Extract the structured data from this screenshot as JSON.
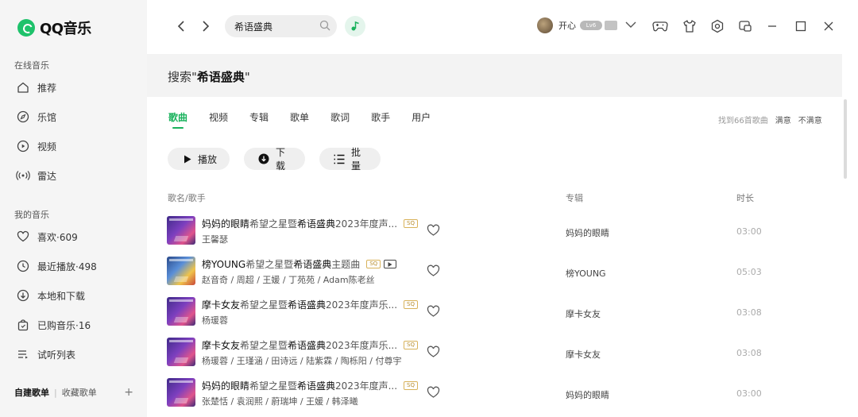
{
  "app": {
    "name": "QQ音乐"
  },
  "sidebar": {
    "online_heading": "在线音乐",
    "online_items": [
      {
        "label": "推荐",
        "icon": "home-icon"
      },
      {
        "label": "乐馆",
        "icon": "compass-icon"
      },
      {
        "label": "视频",
        "icon": "play-circle-icon"
      },
      {
        "label": "雷达",
        "icon": "radar-icon"
      }
    ],
    "my_heading": "我的音乐",
    "my_items": [
      {
        "label": "喜欢·609",
        "icon": "heart-icon"
      },
      {
        "label": "最近播放·498",
        "icon": "clock-icon"
      },
      {
        "label": "本地和下载",
        "icon": "download-icon"
      },
      {
        "label": "已购音乐·16",
        "icon": "bag-icon"
      },
      {
        "label": "试听列表",
        "icon": "list-icon"
      }
    ],
    "bottom": {
      "created": "自建歌单",
      "collected": "收藏歌单",
      "add": "+"
    }
  },
  "header": {
    "search_value": "希语盛典",
    "user_name": "开心",
    "badge_text": "Lv6"
  },
  "main": {
    "search_prefix": "搜索\"",
    "search_keyword": "希语盛典",
    "search_suffix": "\"",
    "tabs": [
      "歌曲",
      "视频",
      "专辑",
      "歌单",
      "歌词",
      "歌手",
      "用户"
    ],
    "result_count": "找到66首歌曲",
    "satisfied": "满意",
    "unsatisfied": "不满意",
    "actions": {
      "play": "播放",
      "download": "下载",
      "batch": "批量"
    },
    "columns": {
      "song": "歌名/歌手",
      "album": "专辑",
      "duration": "时长"
    },
    "songs": [
      {
        "name": "妈妈的眼睛",
        "desc_pre": "希望之星暨",
        "desc_hl": "希语盛典",
        "desc_post": "2023年度声...",
        "artists": "王馨瑟",
        "album": "妈妈的眼睛",
        "duration": "03:00",
        "sq": "SQ"
      },
      {
        "name": "榜YOUNG",
        "desc_pre": "希望之星暨",
        "desc_hl": "希语盛典",
        "desc_post": "主题曲",
        "artists": "赵音奇 / 周超 / 王媛 / 丁苑苑 / Adam陈老丝",
        "album": "榜YOUNG",
        "duration": "05:03",
        "sq": "SQ"
      },
      {
        "name": "摩卡女友",
        "desc_pre": "希望之星暨",
        "desc_hl": "希语盛典",
        "desc_post": "2023年度声乐...",
        "artists": "杨瑗蓉",
        "album": "摩卡女友",
        "duration": "03:08",
        "sq": "SQ"
      },
      {
        "name": "摩卡女友",
        "desc_pre": "希望之星暨",
        "desc_hl": "希语盛典",
        "desc_post": "2023年度声乐...",
        "artists": "杨瑗蓉 / 王瑾涵 / 田诗远 / 陆紫霖 / 陶栎阳 / 付尊宇",
        "album": "摩卡女友",
        "duration": "03:08",
        "sq": "SQ"
      },
      {
        "name": "妈妈的眼睛",
        "desc_pre": "希望之星暨",
        "desc_hl": "希语盛典",
        "desc_post": "2023年度声...",
        "artists": "张楚恬 / 袁润熙 / 蔚瑞坤 / 王媛 / 韩泽曦",
        "album": "妈妈的眼睛",
        "duration": "03:00",
        "sq": "SQ"
      }
    ]
  },
  "colors": {
    "accent": "#19b25c",
    "brand": "#1ec26b"
  }
}
